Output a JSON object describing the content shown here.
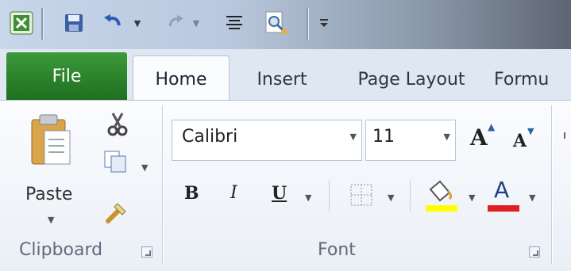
{
  "qat": {
    "icons": [
      "excel-icon",
      "save-icon",
      "undo-icon",
      "redo-icon",
      "align-icon",
      "print-preview-icon",
      "customize-icon"
    ]
  },
  "tabs": {
    "file": "File",
    "home": "Home",
    "insert": "Insert",
    "page_layout": "Page Layout",
    "formulas": "Formu"
  },
  "clipboard": {
    "paste_label": "Paste",
    "group_label": "Clipboard"
  },
  "font": {
    "font_name": "Calibri",
    "font_size": "11",
    "bold": "B",
    "italic": "I",
    "underline": "U",
    "grow": "A",
    "shrink": "A",
    "font_color_letter": "A",
    "group_label": "Font"
  },
  "colors": {
    "highlight": "#ffff00",
    "font_color": "#e02020",
    "file_tab": "#2e8b2e"
  }
}
